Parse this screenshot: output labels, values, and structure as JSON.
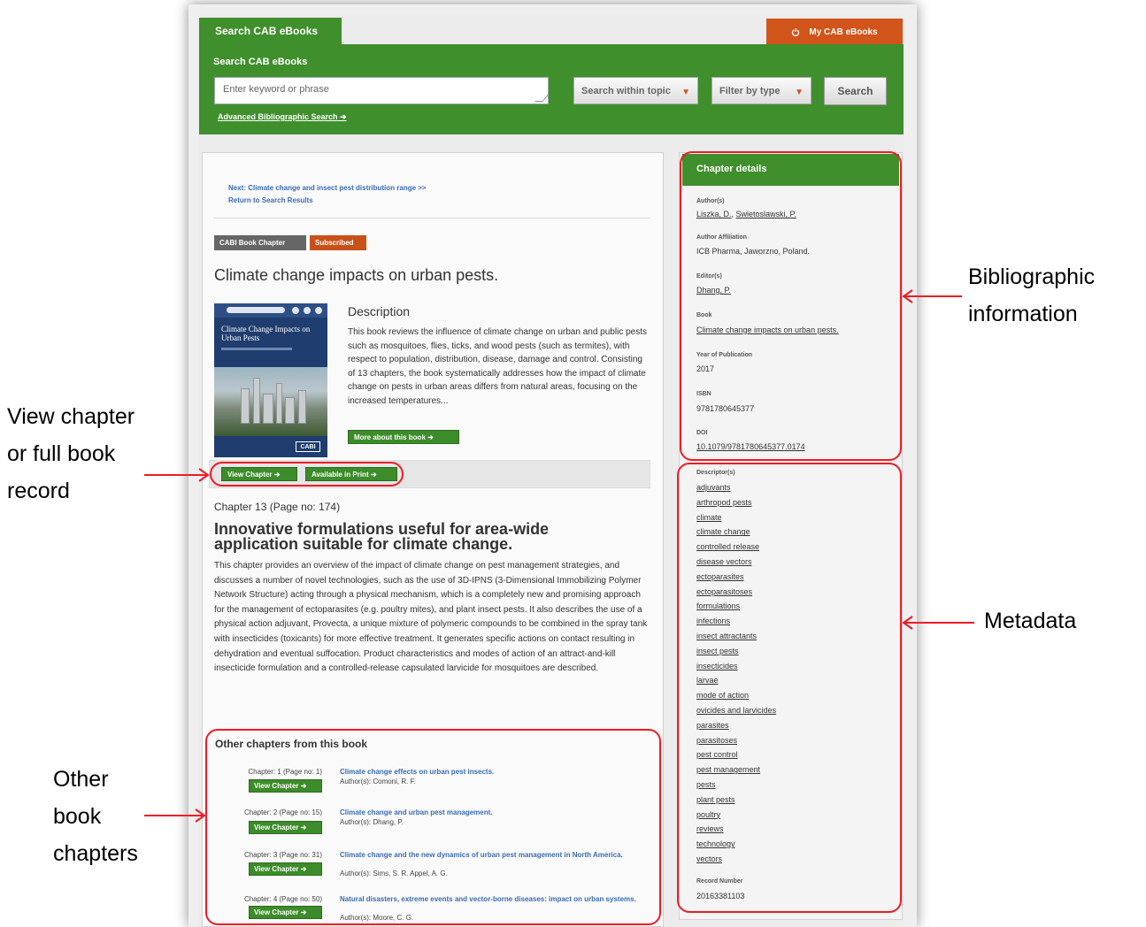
{
  "header": {
    "search_tab": "Search CAB eBooks",
    "my_ebooks": "My CAB eBooks",
    "search_label": "Search CAB eBooks",
    "search_placeholder": "Enter keyword or phrase",
    "within_topic": "Search within topic",
    "filter_type": "Filter by type",
    "search_button": "Search",
    "advanced_search": "Advanced Bibliographic Search"
  },
  "nav": {
    "next_link": "Next: Climate change and insect pest distribution range >>",
    "return_link": "Return to Search Results"
  },
  "book": {
    "type_badge": "CABI Book Chapter",
    "status_badge": "Subscribed",
    "title": "Climate change impacts on urban pests.",
    "cover_title": "Climate Change Impacts on Urban Pests",
    "cover_logo": "CABI",
    "description_heading": "Description",
    "description": "This book reviews the influence of climate change on urban and public pests such as mosquitoes, flies, ticks, and wood pests (such as termites), with respect to population, distribution, disease, damage and control. Consisting of 13 chapters, the book systematically addresses how the impact of climate change on pests in urban areas differs from natural areas, focusing on the increased temperatures...",
    "more_about": "More about this book"
  },
  "actions": {
    "view_chapter": "View Chapter",
    "available_in_print": "Available in Print"
  },
  "chapter": {
    "pages": "Chapter 13 (Page no: 174)",
    "title": "Innovative formulations useful for area-wide application suitable for climate change.",
    "abstract": "This chapter provides an overview of the impact of climate change on pest management strategies, and discusses a number of novel technologies, such as the use of 3D-IPNS (3-Dimensional Immobilizing Polymer Network Structure) acting through a physical mechanism, which is a completely new and promising approach for the management of ectoparasites (e.g. poultry mites), and plant insect pests. It also describes the use of a physical action adjuvant, Provecta, a unique mixture of polymeric compounds to be combined in the spray tank with insecticides (toxicants) for more effective treatment. It generates specific actions on contact resulting in dehydration and eventual suffocation. Product characteristics and modes of action of an attract-and-kill insecticide formulation and a controlled-release capsulated larvicide for mosquitoes are described."
  },
  "other_chapters": {
    "heading": "Other chapters from this book",
    "button": "View Chapter",
    "items": [
      {
        "meta": "Chapter: 1 (Page no: 1)",
        "title": "Climate change effects on urban pest insects.",
        "author": "Author(s): Comoni, R. F."
      },
      {
        "meta": "Chapter: 2 (Page no: 15)",
        "title": "Climate change and urban pest management.",
        "author": "Author(s): Dhang, P."
      },
      {
        "meta": "Chapter: 3 (Page no: 31)",
        "title": "Climate change and the new dynamics of urban pest management in North America.",
        "author": "Author(s): Sims, S. R. Appel, A. G."
      },
      {
        "meta": "Chapter: 4 (Page no: 50)",
        "title": "Natural disasters, extreme events and vector-borne diseases: impact on urban systems.",
        "author": "Author(s): Moore, C. G."
      }
    ]
  },
  "sidebar": {
    "heading": "Chapter details",
    "author_label": "Author(s)",
    "author_1": "Liszka, D.",
    "author_2": "Swietoslawski, P.",
    "affiliation_label": "Author Affiliation",
    "affiliation": "ICB Pharma, Jaworzno, Poland.",
    "editor_label": "Editor(s)",
    "editor": "Dhang, P.",
    "book_label": "Book",
    "book": "Climate change impacts on urban pests.",
    "year_label": "Year of Publication",
    "year": "2017",
    "isbn_label": "ISBN",
    "isbn": "9781780645377",
    "doi_label": "DOI",
    "doi": "10.1079/9781780645377.0174",
    "descriptors_label": "Descriptor(s)",
    "descriptors": [
      "adjuvants",
      "arthropod pests",
      "climate",
      "climate change",
      "controlled release",
      "disease vectors",
      "ectoparasites",
      "ectoparasitoses",
      "formulations",
      "infections",
      "insect attractants",
      "insect pests",
      "insecticides",
      "larvae",
      "mode of action",
      "ovicides and larvicides",
      "parasites",
      "parasitoses",
      "pest control",
      "pest management",
      "pests",
      "plant pests",
      "poultry",
      "reviews",
      "technology",
      "vectors"
    ],
    "record_label": "Record Number",
    "record": "20163381103"
  },
  "annotations": {
    "bibliographic": "Bibliographic information",
    "metadata": "Metadata",
    "view_chapter": "View chapter or full book record",
    "other_chapters": "Other book chapters",
    "color": "#ee1c25"
  }
}
